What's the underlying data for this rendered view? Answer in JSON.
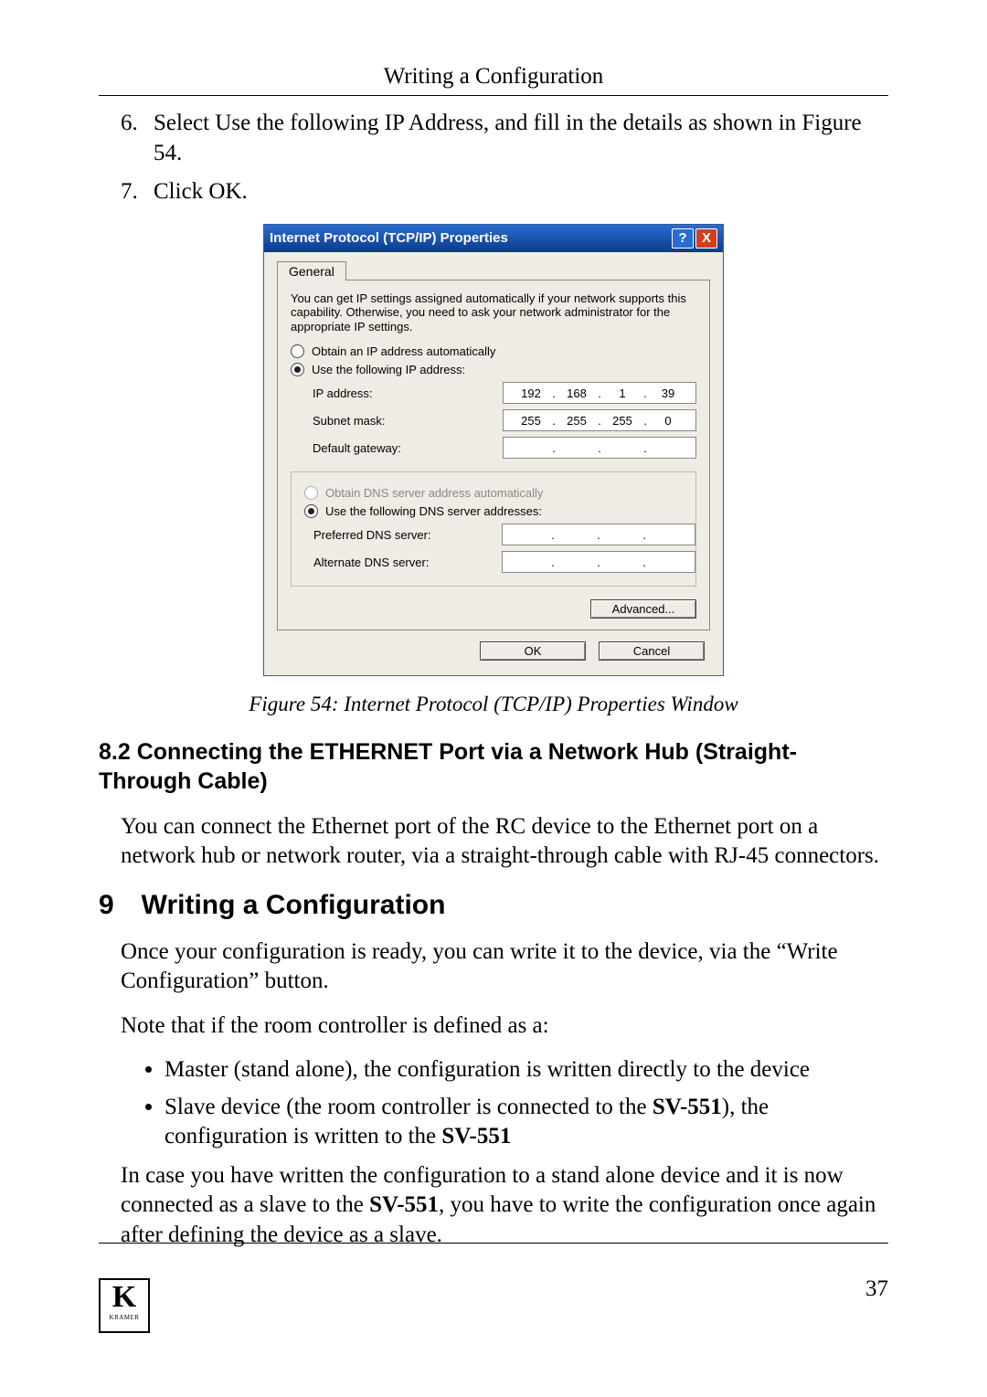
{
  "header": {
    "running": "Writing a Configuration"
  },
  "steps": {
    "s6": "Select Use the following IP Address, and fill in the details as shown in Figure 54.",
    "s7": "Click OK."
  },
  "dialog": {
    "title": "Internet Protocol (TCP/IP) Properties",
    "tab": "General",
    "explanation": "You can get IP settings assigned automatically if your network supports this capability. Otherwise, you need to ask your network administrator for the appropriate IP settings.",
    "radio_auto_ip": "Obtain an IP address automatically",
    "radio_static_ip": "Use the following IP address:",
    "lbl_ip": "IP address:",
    "lbl_subnet": "Subnet mask:",
    "lbl_gateway": "Default gateway:",
    "radio_auto_dns": "Obtain DNS server address automatically",
    "radio_static_dns": "Use the following DNS server addresses:",
    "lbl_pref_dns": "Preferred DNS server:",
    "lbl_alt_dns": "Alternate DNS server:",
    "btn_advanced": "Advanced...",
    "btn_ok": "OK",
    "btn_cancel": "Cancel",
    "ip": {
      "o1": "192",
      "o2": "168",
      "o3": "1",
      "o4": "39"
    },
    "subnet": {
      "o1": "255",
      "o2": "255",
      "o3": "255",
      "o4": "0"
    },
    "gateway": {
      "o1": "",
      "o2": "",
      "o3": "",
      "o4": ""
    },
    "pref_dns": {
      "o1": "",
      "o2": "",
      "o3": "",
      "o4": ""
    },
    "alt_dns": {
      "o1": "",
      "o2": "",
      "o3": "",
      "o4": ""
    }
  },
  "caption": "Figure 54: Internet Protocol (TCP/IP) Properties Window",
  "sec82_title": "8.2 Connecting the ETHERNET Port via a Network Hub (Straight-Through Cable)",
  "sec82_para": "You can connect the Ethernet port of the RC device to the Ethernet port on a network hub or network router, via a straight-through cable with RJ-45 connectors.",
  "sec9_title": "9 Writing a Configuration",
  "sec9_p1": "Once your configuration is ready, you can write it to the device, via the “Write Configuration” button.",
  "sec9_p2": "Note that if the room controller is defined as a:",
  "sec9_b1": "Master (stand alone), the configuration is written directly to the device",
  "sec9_b2_a": "Slave device (the room controller is connected to the ",
  "sec9_b2_bold1": "SV-551",
  "sec9_b2_b": "), the configuration is written to the ",
  "sec9_b2_bold2": "SV-551",
  "sec9_p3_a": "In case you have written the configuration to a stand alone device and it is now connected as a slave to the ",
  "sec9_p3_bold": "SV-551",
  "sec9_p3_b": ", you have to write the configuration once again after defining the device as a slave.",
  "page_number": "37",
  "logo": {
    "k": "K",
    "brand": "KRAMER"
  }
}
